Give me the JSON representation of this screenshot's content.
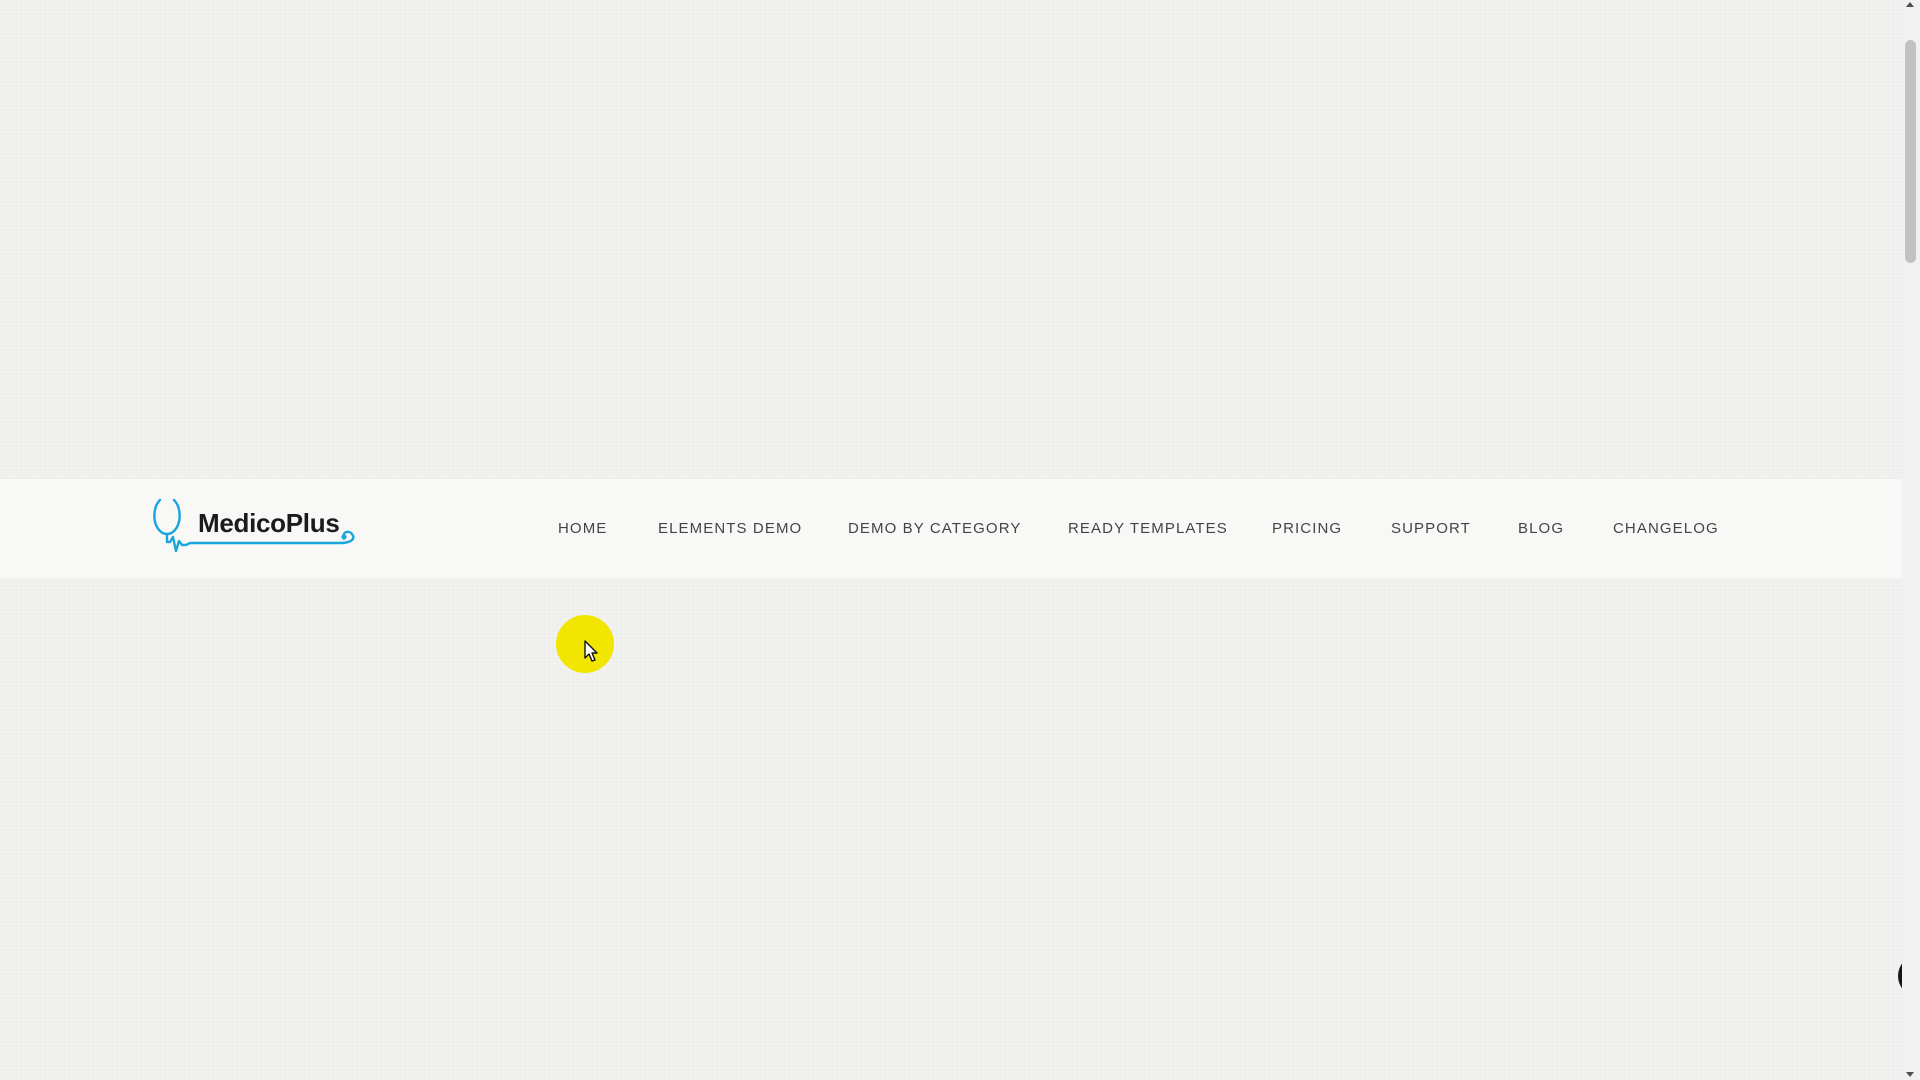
{
  "logo": {
    "text": "MedicoPlus",
    "accent_color": "#1aa6dd",
    "icon": "stethoscope-icon"
  },
  "nav": {
    "items": [
      {
        "label": "HOME"
      },
      {
        "label": "ELEMENTS DEMO"
      },
      {
        "label": "DEMO BY CATEGORY"
      },
      {
        "label": "READY TEMPLATES"
      },
      {
        "label": "PRICING"
      },
      {
        "label": "SUPPORT"
      },
      {
        "label": "BLOG"
      },
      {
        "label": "CHANGELOG"
      }
    ]
  },
  "cursor": {
    "highlight_color": "#f2e600",
    "icon": "mouse-pointer-icon"
  },
  "float_button": {
    "icon": "chevron-left-icon",
    "glyph": "‹"
  },
  "colors": {
    "background": "#f1f1ef",
    "header_background": "#f8f8f7",
    "nav_text": "#444444"
  }
}
